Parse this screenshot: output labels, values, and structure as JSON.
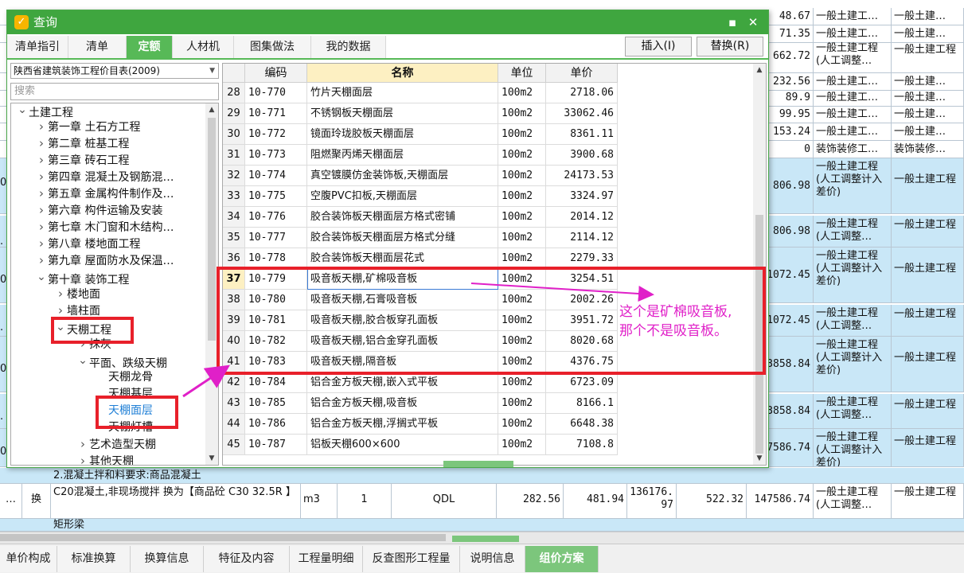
{
  "dialog": {
    "title": "查询",
    "logo_glyph": "✓",
    "min_glyph": "▪",
    "close_glyph": "✕",
    "tabs": [
      {
        "label": "清单指引",
        "active": false
      },
      {
        "label": "清单",
        "active": false
      },
      {
        "label": "定额",
        "active": true
      },
      {
        "label": "人材机",
        "active": false
      },
      {
        "label": "图集做法",
        "active": false
      },
      {
        "label": "我的数据",
        "active": false
      }
    ],
    "insert_button": "插入(I)",
    "replace_button": "替换(R)",
    "library": "陕西省建筑装饰工程价目表(2009)",
    "search_placeholder": "搜索",
    "tree": [
      {
        "label": "土建工程",
        "level": 0,
        "toggle": "expanded"
      },
      {
        "label": "第一章 土石方工程",
        "level": 1,
        "toggle": "collapsed"
      },
      {
        "label": "第二章 桩基工程",
        "level": 1,
        "toggle": "collapsed"
      },
      {
        "label": "第三章 砖石工程",
        "level": 1,
        "toggle": "collapsed"
      },
      {
        "label": "第四章 混凝土及钢筋混…",
        "level": 1,
        "toggle": "collapsed"
      },
      {
        "label": "第五章 金属构件制作及…",
        "level": 1,
        "toggle": "collapsed"
      },
      {
        "label": "第六章 构件运输及安装",
        "level": 1,
        "toggle": "collapsed"
      },
      {
        "label": "第七章 木门窗和木结构…",
        "level": 1,
        "toggle": "collapsed"
      },
      {
        "label": "第八章 楼地面工程",
        "level": 1,
        "toggle": "collapsed"
      },
      {
        "label": "第九章 屋面防水及保温…",
        "level": 1,
        "toggle": "collapsed"
      },
      {
        "label": "第十章 装饰工程",
        "level": 1,
        "toggle": "expanded"
      },
      {
        "label": "楼地面",
        "level": 2,
        "toggle": "collapsed"
      },
      {
        "label": "墙柱面",
        "level": 2,
        "toggle": "collapsed"
      },
      {
        "label": "天棚工程",
        "level": 2,
        "toggle": "expanded"
      },
      {
        "label": "抹灰",
        "level": 3,
        "toggle": "collapsed"
      },
      {
        "label": "平面、跌级天棚",
        "level": 3,
        "toggle": "expanded"
      },
      {
        "label": "天棚龙骨",
        "level": 4,
        "toggle": "none"
      },
      {
        "label": "天棚基层",
        "level": 4,
        "toggle": "none"
      },
      {
        "label": "天棚面层",
        "level": 4,
        "toggle": "none",
        "selected": true
      },
      {
        "label": "天棚灯槽",
        "level": 4,
        "toggle": "none"
      },
      {
        "label": "艺术造型天棚",
        "level": 3,
        "toggle": "collapsed"
      },
      {
        "label": "其他天棚",
        "level": 3,
        "toggle": "collapsed"
      }
    ],
    "grid": {
      "headers": [
        "",
        "编码",
        "名称",
        "单位",
        "单价"
      ],
      "rows": [
        {
          "no": "28",
          "code": "10-770",
          "name": "竹片天棚面层",
          "unit": "100m2",
          "price": "2718.06"
        },
        {
          "no": "29",
          "code": "10-771",
          "name": "不锈钢板天棚面层",
          "unit": "100m2",
          "price": "33062.46"
        },
        {
          "no": "30",
          "code": "10-772",
          "name": "镜面玲珑胶板天棚面层",
          "unit": "100m2",
          "price": "8361.11"
        },
        {
          "no": "31",
          "code": "10-773",
          "name": "阻燃聚丙烯天棚面层",
          "unit": "100m2",
          "price": "3900.68"
        },
        {
          "no": "32",
          "code": "10-774",
          "name": "真空镀膜仿金装饰板,天棚面层",
          "unit": "100m2",
          "price": "24173.53"
        },
        {
          "no": "33",
          "code": "10-775",
          "name": "空腹PVC扣板,天棚面层",
          "unit": "100m2",
          "price": "3324.97"
        },
        {
          "no": "34",
          "code": "10-776",
          "name": "胶合装饰板天棚面层方格式密铺",
          "unit": "100m2",
          "price": "2014.12"
        },
        {
          "no": "35",
          "code": "10-777",
          "name": "胶合装饰板天棚面层方格式分缝",
          "unit": "100m2",
          "price": "2114.12"
        },
        {
          "no": "36",
          "code": "10-778",
          "name": "胶合装饰板天棚面层花式",
          "unit": "100m2",
          "price": "2279.33"
        },
        {
          "no": "37",
          "code": "10-779",
          "name": "吸音板天棚,矿棉吸音板",
          "unit": "100m2",
          "price": "3254.51",
          "current": true
        },
        {
          "no": "38",
          "code": "10-780",
          "name": "吸音板天棚,石膏吸音板",
          "unit": "100m2",
          "price": "2002.26"
        },
        {
          "no": "39",
          "code": "10-781",
          "name": "吸音板天棚,胶合板穿孔面板",
          "unit": "100m2",
          "price": "3951.72"
        },
        {
          "no": "40",
          "code": "10-782",
          "name": "吸音板天棚,铝合金穿孔面板",
          "unit": "100m2",
          "price": "8020.68"
        },
        {
          "no": "41",
          "code": "10-783",
          "name": "吸音板天棚,隔音板",
          "unit": "100m2",
          "price": "4376.75"
        },
        {
          "no": "42",
          "code": "10-784",
          "name": "铝合金方板天棚,嵌入式平板",
          "unit": "100m2",
          "price": "6723.09"
        },
        {
          "no": "43",
          "code": "10-785",
          "name": "铝合金方板天棚,吸音板",
          "unit": "100m2",
          "price": "8166.1"
        },
        {
          "no": "44",
          "code": "10-786",
          "name": "铝合金方板天棚,浮搁式平板",
          "unit": "100m2",
          "price": "6648.38"
        },
        {
          "no": "45",
          "code": "10-787",
          "name": "铝板天棚600×600",
          "unit": "100m2",
          "price": "7108.8"
        }
      ]
    }
  },
  "annotation": {
    "line1": "这个是矿棉吸音板,",
    "line2": "那个不是吸音板。",
    "color": "#e020c8",
    "box_color": "#e8202a"
  },
  "background_sheet": {
    "top_text": "…",
    "right_rows": [
      {
        "amount": "48.67",
        "cat1": "一般土建工…",
        "cat2": "一般土建…"
      },
      {
        "amount": "71.35",
        "cat1": "一般土建工…",
        "cat2": "一般土建…"
      },
      {
        "amount": "662.72",
        "cat1": "一般土建工程(人工调整…",
        "cat2": "一般土建工程"
      },
      {
        "amount": "232.56",
        "cat1": "一般土建工…",
        "cat2": "一般土建…"
      },
      {
        "amount": "89.9",
        "cat1": "一般土建工…",
        "cat2": "一般土建…"
      },
      {
        "amount": "99.95",
        "cat1": "一般土建工…",
        "cat2": "一般土建…"
      },
      {
        "amount": "153.24",
        "cat1": "一般土建工…",
        "cat2": "一般土建…"
      },
      {
        "amount": "0",
        "cat1": "装饰装修工…",
        "cat2": "装饰装修…"
      },
      {
        "amount": "806.98",
        "cat1": "一般土建工程(人工调整计入差价)",
        "cat2": "一般土建工程"
      },
      {
        "amount": "806.98",
        "cat1": "一般土建工程(人工调整…",
        "cat2": "一般土建工程"
      },
      {
        "amount": "1072.45",
        "cat1": "一般土建工程(人工调整计入差价)",
        "cat2": "一般土建工程"
      },
      {
        "amount": "1072.45",
        "cat1": "一般土建工程(人工调整…",
        "cat2": "一般土建工程"
      },
      {
        "amount": "3858.84",
        "cat1": "一般土建工程(人工调整计入差价)",
        "cat2": "一般土建工程"
      },
      {
        "amount": "3858.84",
        "cat1": "一般土建工程(人工调整…",
        "cat2": "一般土建工程"
      },
      {
        "amount": "47586.74",
        "cat1": "一般土建工程(人工调整计入差价)",
        "cat2": "一般土建工程"
      }
    ],
    "left_marks": [
      "0",
      ".",
      "0",
      ".",
      "0",
      ".",
      "0"
    ],
    "req_row": "2.混凝土拌和料要求:商品混凝土",
    "main_row": {
      "seq": "…",
      "type": "换",
      "name": "C20混凝土,非现场搅拌  换为【商品砼 C30 32.5R 】",
      "unit": "m3",
      "qty": "1",
      "expr": "QDL",
      "price1": "282.56",
      "price2": "481.94",
      "price3": "136176.97",
      "price4": "522.32",
      "amount": "147586.74",
      "cat1": "一般土建工程(人工调整…",
      "cat2": "一般土建工程"
    },
    "next_row": "矩形梁"
  },
  "bottom_tabs": [
    {
      "label": "单价构成",
      "active": false
    },
    {
      "label": "标准换算",
      "active": false
    },
    {
      "label": "换算信息",
      "active": false
    },
    {
      "label": "特征及内容",
      "active": false
    },
    {
      "label": "工程量明细",
      "active": false
    },
    {
      "label": "反查图形工程量",
      "active": false
    },
    {
      "label": "说明信息",
      "active": false
    },
    {
      "label": "组价方案",
      "active": true
    }
  ]
}
